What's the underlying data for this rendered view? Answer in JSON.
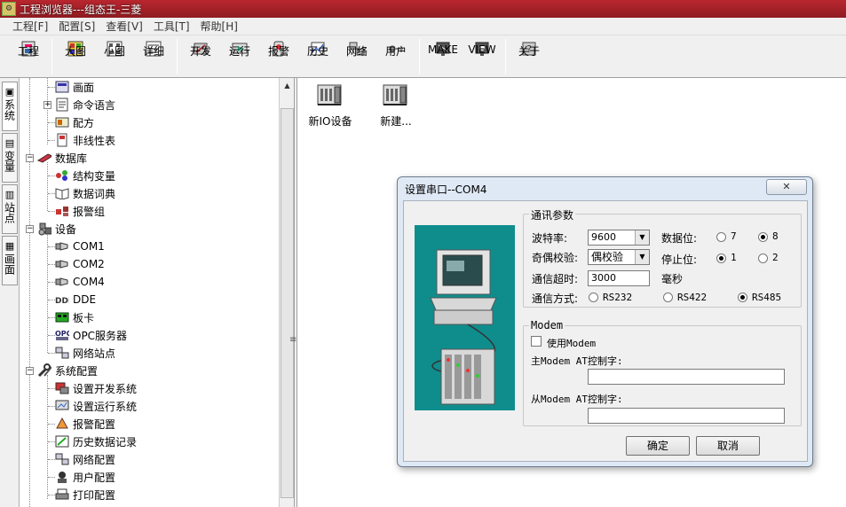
{
  "window": {
    "title": "工程浏览器---组态王-三菱",
    "app_icon": "kingview-app-icon"
  },
  "menu": [
    "工程[F]",
    "配置[S]",
    "查看[V]",
    "工具[T]",
    "帮助[H]"
  ],
  "toolbar": {
    "buttons": [
      {
        "label": "工程",
        "icon": "project-icon"
      },
      {
        "label": "大图",
        "icon": "large-icons-icon"
      },
      {
        "label": "小图",
        "icon": "small-icons-icon"
      },
      {
        "label": "详细",
        "icon": "details-icon"
      },
      {
        "label": "开发",
        "icon": "develop-icon"
      },
      {
        "label": "运行",
        "icon": "run-icon"
      },
      {
        "label": "报警",
        "icon": "alarm-icon"
      },
      {
        "label": "历史",
        "icon": "history-icon"
      },
      {
        "label": "网络",
        "icon": "network-icon"
      },
      {
        "label": "用户",
        "icon": "user-icon"
      },
      {
        "label": "MAKE",
        "icon": "make-icon"
      },
      {
        "label": "VIEW",
        "icon": "view-icon"
      },
      {
        "label": "关于",
        "icon": "about-icon"
      }
    ]
  },
  "side_tabs": [
    {
      "label": "系统",
      "icon": "system-tab-icon"
    },
    {
      "label": "变量",
      "icon": "variable-tab-icon"
    },
    {
      "label": "站点",
      "icon": "station-tab-icon"
    },
    {
      "label": "画面",
      "icon": "screen-tab-icon"
    }
  ],
  "tree": {
    "items": [
      {
        "label": "画面",
        "icon": "screen-icon"
      },
      {
        "label": "命令语言",
        "icon": "command-language-icon"
      },
      {
        "label": "配方",
        "icon": "recipe-icon"
      },
      {
        "label": "非线性表",
        "icon": "nonlinear-table-icon"
      },
      {
        "label": "数据库",
        "icon": "database-icon"
      },
      {
        "label": "结构变量",
        "icon": "struct-variable-icon"
      },
      {
        "label": "数据词典",
        "icon": "data-dictionary-icon"
      },
      {
        "label": "报警组",
        "icon": "alarm-group-icon"
      },
      {
        "label": "设备",
        "icon": "device-icon"
      },
      {
        "label": "COM1",
        "icon": "com-port-icon"
      },
      {
        "label": "COM2",
        "icon": "com-port-icon"
      },
      {
        "label": "COM4",
        "icon": "com-port-icon"
      },
      {
        "label": "DDE",
        "icon": "dde-icon"
      },
      {
        "label": "板卡",
        "icon": "board-card-icon"
      },
      {
        "label": "OPC服务器",
        "icon": "opc-server-icon"
      },
      {
        "label": "网络站点",
        "icon": "network-station-icon"
      },
      {
        "label": "系统配置",
        "icon": "system-config-icon"
      },
      {
        "label": "设置开发系统",
        "icon": "dev-system-settings-icon"
      },
      {
        "label": "设置运行系统",
        "icon": "run-system-settings-icon"
      },
      {
        "label": "报警配置",
        "icon": "alarm-config-icon"
      },
      {
        "label": "历史数据记录",
        "icon": "history-record-icon"
      },
      {
        "label": "网络配置",
        "icon": "network-config-icon"
      },
      {
        "label": "用户配置",
        "icon": "user-config-icon"
      },
      {
        "label": "打印配置",
        "icon": "print-config-icon"
      }
    ]
  },
  "content": {
    "icons": [
      {
        "label": "新IO设备",
        "icon": "new-io-device-icon"
      },
      {
        "label": "新建...",
        "icon": "new-device-icon"
      }
    ]
  },
  "dialog": {
    "title": "设置串口--COM4",
    "close_label": "✕",
    "comm_group": "通讯参数",
    "baud_label": "波特率:",
    "baud_value": "9600",
    "databits_label": "数据位:",
    "databits_options": [
      "7",
      "8"
    ],
    "databits_selected": "8",
    "parity_label": "奇偶校验:",
    "parity_value": "偶校验",
    "stopbits_label": "停止位:",
    "stopbits_options": [
      "1",
      "2"
    ],
    "stopbits_selected": "1",
    "timeout_label": "通信超时:",
    "timeout_value": "3000",
    "timeout_unit": "毫秒",
    "mode_label": "通信方式:",
    "mode_options": [
      "RS232",
      "RS422",
      "RS485"
    ],
    "mode_selected": "RS485",
    "modem_group": "Modem",
    "use_modem_label": "使用Modem",
    "use_modem_checked": false,
    "master_modem_label": "主Modem AT控制字:",
    "master_modem_value": "",
    "slave_modem_label": "从Modem AT控制字:",
    "slave_modem_value": "",
    "ok_label": "确定",
    "cancel_label": "取消"
  },
  "colors": {
    "title_bar": "#a8222a",
    "illustration_bg": "#0f8d8d"
  }
}
